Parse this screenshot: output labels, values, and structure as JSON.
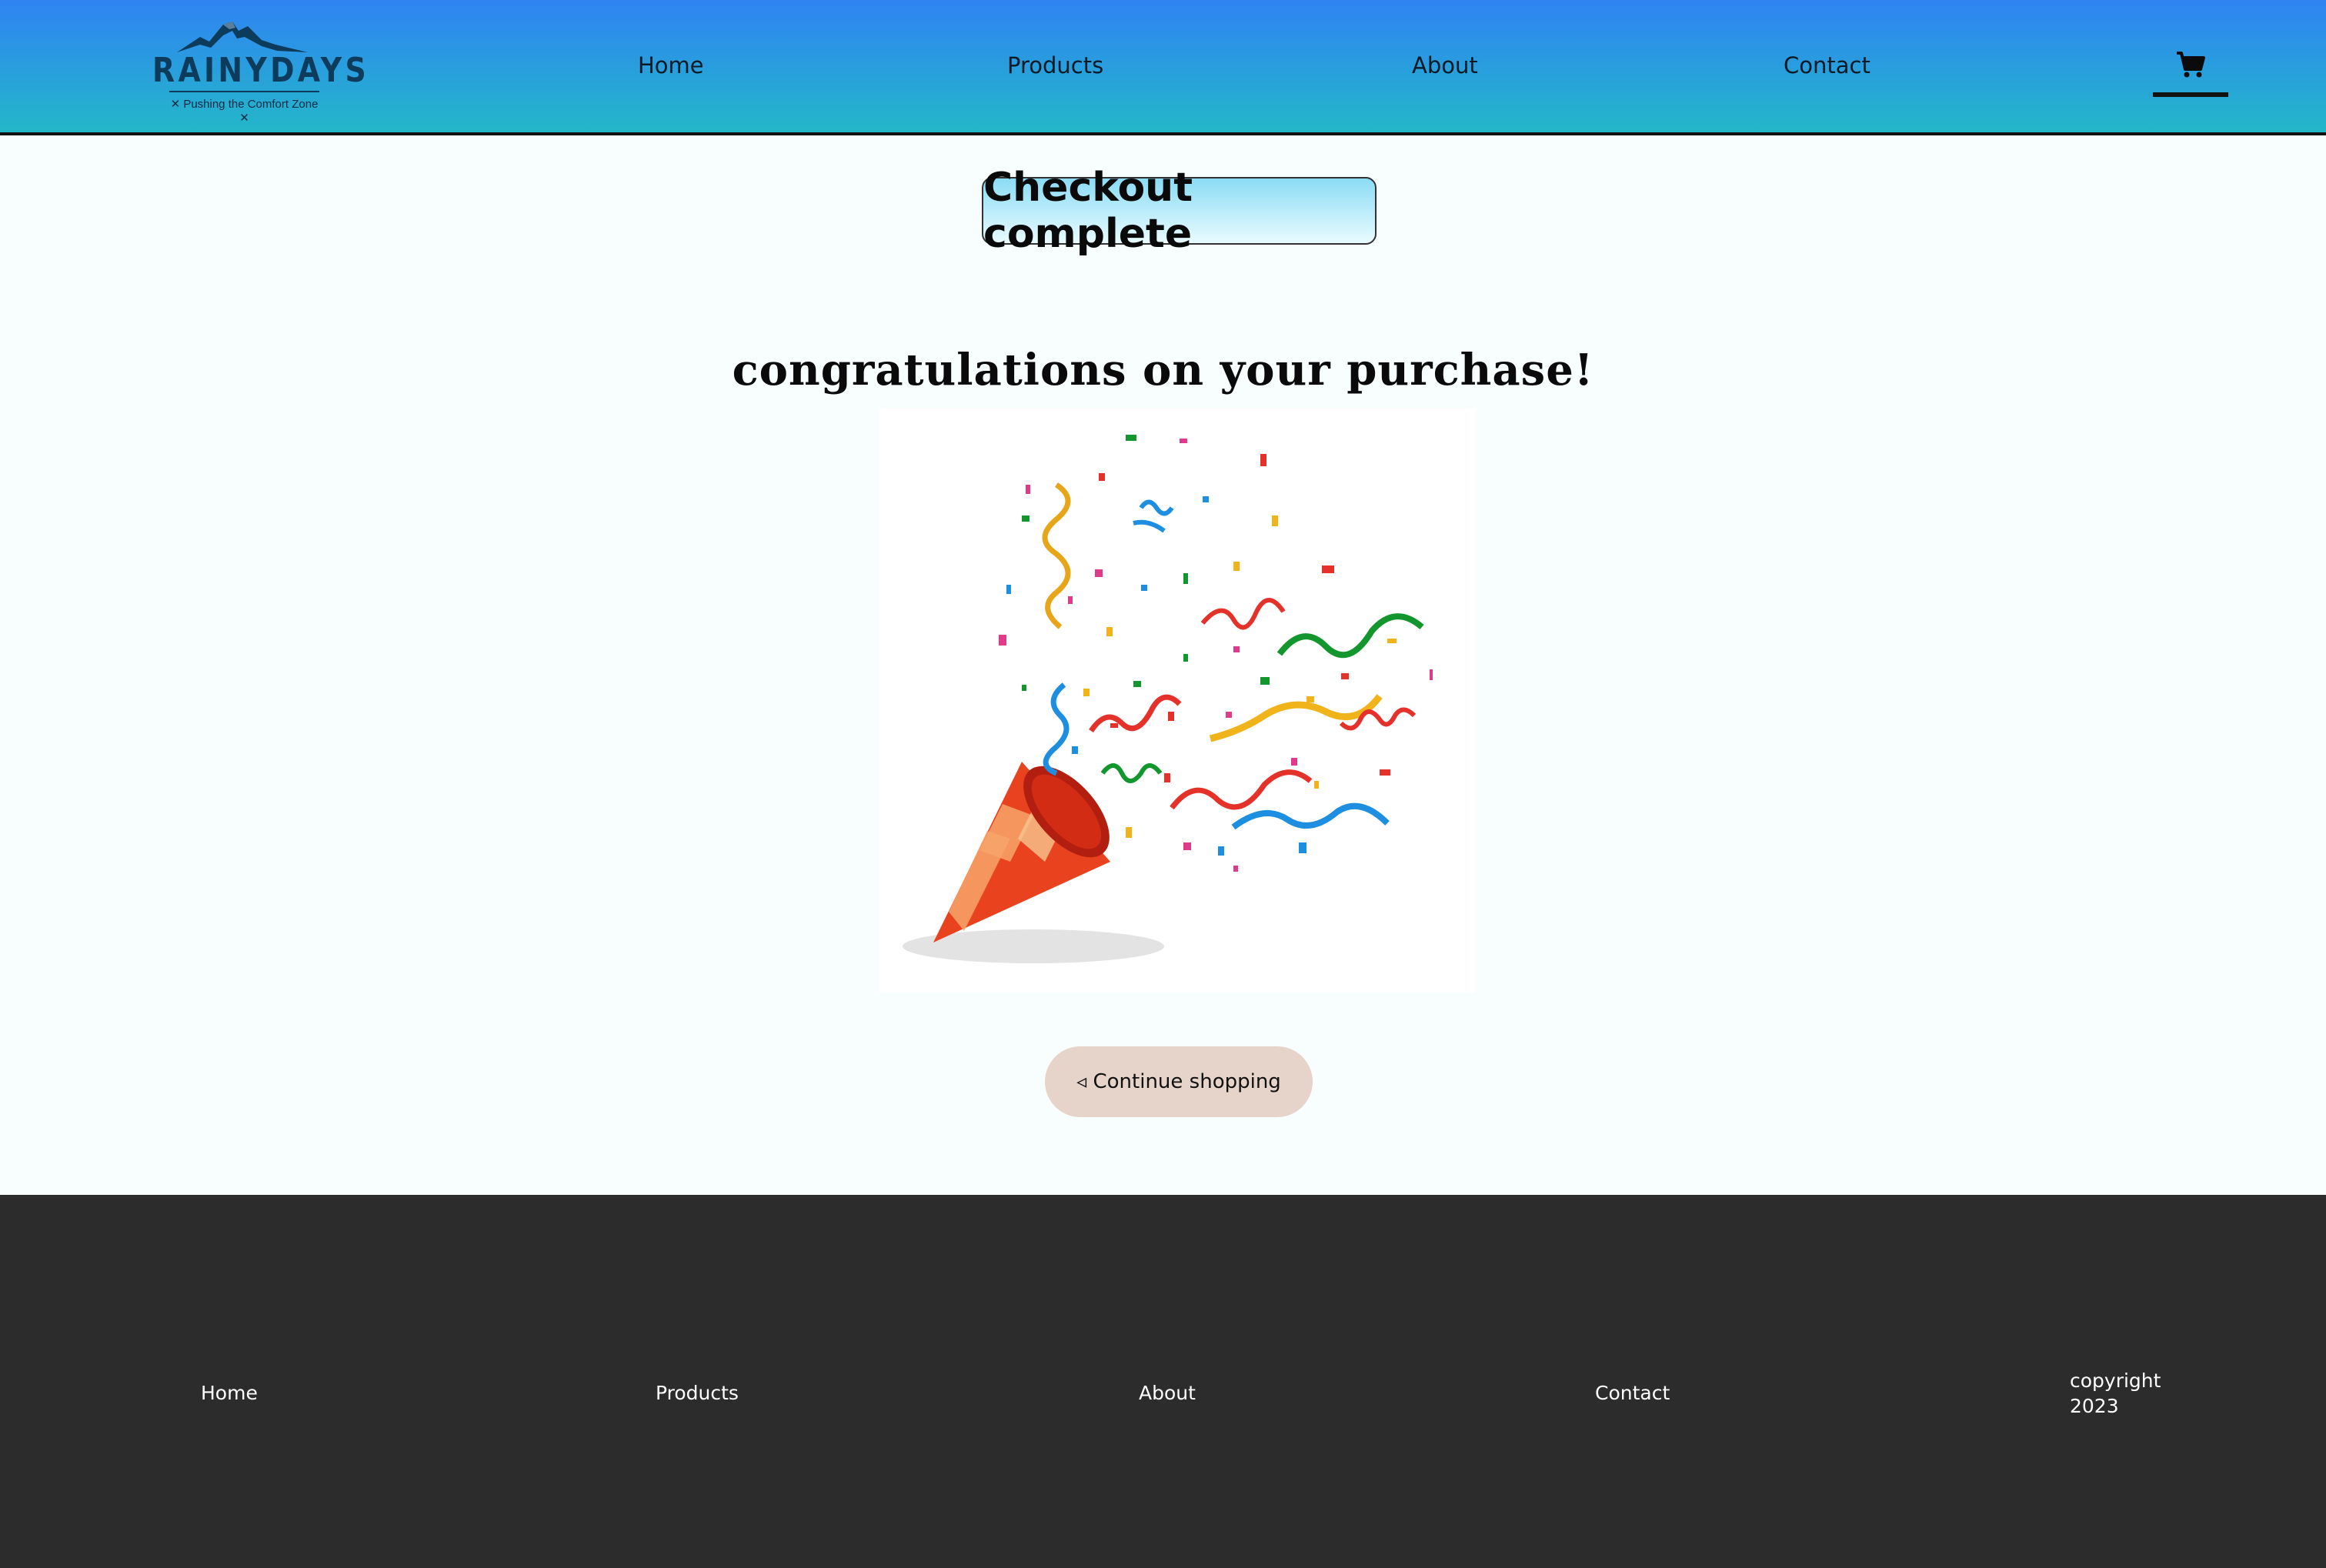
{
  "brand": {
    "name": "RAINYDAYS",
    "tagline": "✕ Pushing the Comfort Zone ✕"
  },
  "nav": {
    "items": [
      {
        "label": "Home"
      },
      {
        "label": "Products"
      },
      {
        "label": "About"
      },
      {
        "label": "Contact"
      }
    ],
    "cart_icon": "shopping-cart-icon"
  },
  "main": {
    "page_title": "Checkout complete",
    "congratulations": "congratulations on your purchase!",
    "illustration": "party-popper-confetti",
    "continue_label": "◃ Continue shopping"
  },
  "footer": {
    "items": [
      {
        "label": "Home"
      },
      {
        "label": "Products"
      },
      {
        "label": "About"
      },
      {
        "label": "Contact"
      }
    ],
    "copyright": "copyright 2023"
  },
  "colors": {
    "header_top": "#2f83f3",
    "header_bottom": "#23b7c8",
    "footer_bg": "#2c2c2c",
    "button_bg": "#e6d3c9",
    "page_bg": "#f8fefe"
  }
}
